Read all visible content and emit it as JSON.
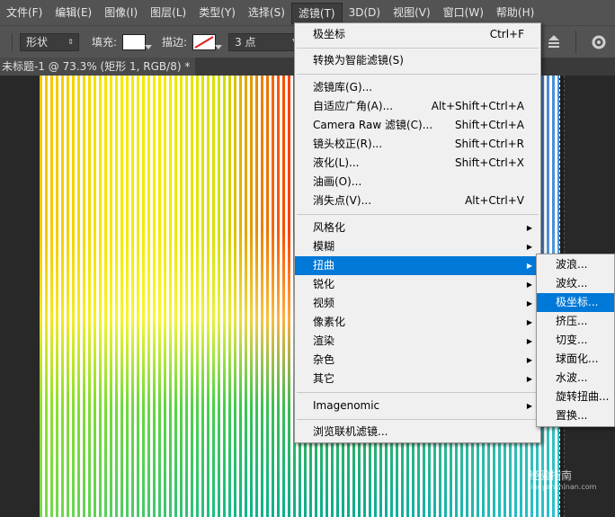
{
  "menubar": {
    "items": [
      "文件(F)",
      "编辑(E)",
      "图像(I)",
      "图层(L)",
      "类型(Y)",
      "选择(S)",
      "滤镜(T)",
      "3D(D)",
      "视图(V)",
      "窗口(W)",
      "帮助(H)"
    ],
    "active_index": 6
  },
  "options": {
    "mode_value": "形状",
    "fill_label": "填充:",
    "stroke_label": "描边:",
    "stroke_size": "3 点"
  },
  "tab": {
    "title": "未标题-1 @ 73.3% (矩形 1, RGB/8) *"
  },
  "filter_menu": {
    "items": [
      {
        "label": "极坐标",
        "shortcut": "Ctrl+F"
      },
      {
        "label": "转换为智能滤镜(S)",
        "shortcut": ""
      },
      {
        "label": "滤镜库(G)...",
        "shortcut": ""
      },
      {
        "label": "自适应广角(A)...",
        "shortcut": "Alt+Shift+Ctrl+A"
      },
      {
        "label": "Camera Raw 滤镜(C)...",
        "shortcut": "Shift+Ctrl+A"
      },
      {
        "label": "镜头校正(R)...",
        "shortcut": "Shift+Ctrl+R"
      },
      {
        "label": "液化(L)...",
        "shortcut": "Shift+Ctrl+X"
      },
      {
        "label": "油画(O)...",
        "shortcut": ""
      },
      {
        "label": "消失点(V)...",
        "shortcut": "Alt+Ctrl+V"
      },
      {
        "label": "风格化",
        "submenu": true
      },
      {
        "label": "模糊",
        "submenu": true
      },
      {
        "label": "扭曲",
        "submenu": true,
        "highlighted": true
      },
      {
        "label": "锐化",
        "submenu": true
      },
      {
        "label": "视频",
        "submenu": true
      },
      {
        "label": "像素化",
        "submenu": true
      },
      {
        "label": "渲染",
        "submenu": true
      },
      {
        "label": "杂色",
        "submenu": true
      },
      {
        "label": "其它",
        "submenu": true
      },
      {
        "label": "Imagenomic",
        "submenu": true
      },
      {
        "label": "浏览联机滤镜...",
        "shortcut": ""
      }
    ]
  },
  "distort_submenu": {
    "items": [
      "波浪...",
      "波纹...",
      "极坐标...",
      "挤压...",
      "切变...",
      "球面化...",
      "水波...",
      "旋转扭曲...",
      "置换..."
    ],
    "highlighted_index": 2
  },
  "watermark": {
    "text": "经验指南",
    "url": "jingyanzhinan.com"
  },
  "colors": {
    "highlight": "#0078d7",
    "menu_bg": "#f0f0f0",
    "ui_dark": "#535353"
  }
}
